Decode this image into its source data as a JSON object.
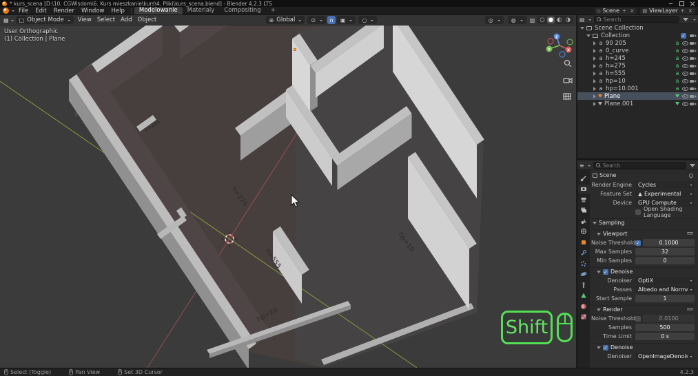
{
  "window": {
    "title": "* kurs_scena [D:\\10. CGWisdom\\6. Kurs mieszkanie\\kurs\\4. Pliki\\kurs_scena.blend] - Blender 4.2.3 LTS"
  },
  "topbar": {
    "menus": [
      "File",
      "Edit",
      "Render",
      "Window",
      "Help"
    ],
    "workspaces": [
      {
        "label": "Modelowanie",
        "active": true
      },
      {
        "label": "Materialy",
        "active": false
      },
      {
        "label": "Compositing",
        "active": false
      },
      {
        "label": "+",
        "active": false
      }
    ],
    "scene_selector": {
      "value": "Scene"
    },
    "view_layer_selector": {
      "value": "ViewLayer"
    }
  },
  "viewport": {
    "header": {
      "mode": "Object Mode",
      "menus": [
        "View",
        "Select",
        "Add",
        "Object"
      ],
      "orientation": "Global"
    },
    "overlay": {
      "line1": "User Orthographic",
      "line2": "(1) Collection | Plane"
    },
    "wall_labels": [
      "h=245",
      "h=275",
      "h=555",
      "hp=10",
      "hp=10"
    ],
    "gizmo_axes": [
      "X",
      "Y",
      "Z"
    ],
    "screencast": {
      "key": "Shift"
    }
  },
  "outliner": {
    "search_placeholder": "Search",
    "scene_collection": "Scene Collection",
    "collection": "Collection",
    "items": [
      {
        "name": "90 205",
        "type": "font"
      },
      {
        "name": "0_curve",
        "type": "font"
      },
      {
        "name": "h=245",
        "type": "font"
      },
      {
        "name": "h=275",
        "type": "font"
      },
      {
        "name": "h=555",
        "type": "font"
      },
      {
        "name": "hp=10",
        "type": "font"
      },
      {
        "name": "hp=10.001",
        "type": "font"
      },
      {
        "name": "Plane",
        "type": "mesh",
        "active": true
      },
      {
        "name": "Plane.001",
        "type": "mesh",
        "active": false
      }
    ]
  },
  "properties": {
    "search_placeholder": "Search",
    "breadcrumb": "Scene",
    "render_engine": {
      "label": "Render Engine",
      "value": "Cycles"
    },
    "feature_set": {
      "label": "Feature Set",
      "value": "Experimental"
    },
    "device": {
      "label": "Device",
      "value": "GPU Compute"
    },
    "osl_label": "Open Shading Language",
    "sampling": {
      "title": "Sampling",
      "viewport": {
        "title": "Viewport",
        "noise_threshold": {
          "label": "Noise Threshold",
          "value": "0.1000",
          "enabled": true
        },
        "max_samples": {
          "label": "Max Samples",
          "value": "32"
        },
        "min_samples": {
          "label": "Min Samples",
          "value": "0"
        },
        "denoise": {
          "title": "Denoise",
          "enabled": true,
          "denoiser": {
            "label": "Denoiser",
            "value": "OptiX"
          },
          "passes": {
            "label": "Passes",
            "value": "Albedo and Normal"
          },
          "start_sample": {
            "label": "Start Sample",
            "value": "1"
          }
        }
      },
      "render": {
        "title": "Render",
        "noise_threshold": {
          "label": "Noise Threshold",
          "value": "0.0100",
          "enabled": false
        },
        "samples": {
          "label": "Samples",
          "value": "500"
        },
        "time_limit": {
          "label": "Time Limit",
          "value": "0 s"
        },
        "denoise": {
          "title": "Denoise",
          "enabled": true,
          "denoiser": {
            "label": "Denoiser",
            "value": "OpenImageDenoise"
          }
        }
      }
    }
  },
  "statusbar": {
    "keymaps": [
      "Select (Toggle)",
      "Pan View",
      "Set 3D Cursor"
    ],
    "version": "4.2.3"
  },
  "colors": {
    "accent_blue": "#4772b3",
    "screencast_green": "#54e054",
    "axis_x": "#b15555",
    "axis_y": "#8a9a3d",
    "object_orange": "#e8862d",
    "data_green": "#58c776",
    "viewport_bg": "#3b3b3b"
  }
}
